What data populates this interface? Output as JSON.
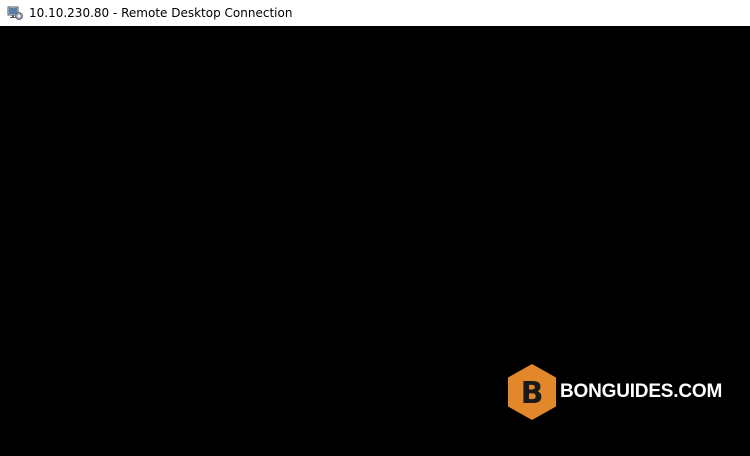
{
  "window": {
    "title": "10.10.230.80 - Remote Desktop Connection",
    "icon": "remote-desktop-icon"
  },
  "remote_screen": {
    "background": "#000000"
  },
  "watermark": {
    "logo_letter": "B",
    "text": "BONGUIDES.COM",
    "accent": "#e2882a"
  }
}
